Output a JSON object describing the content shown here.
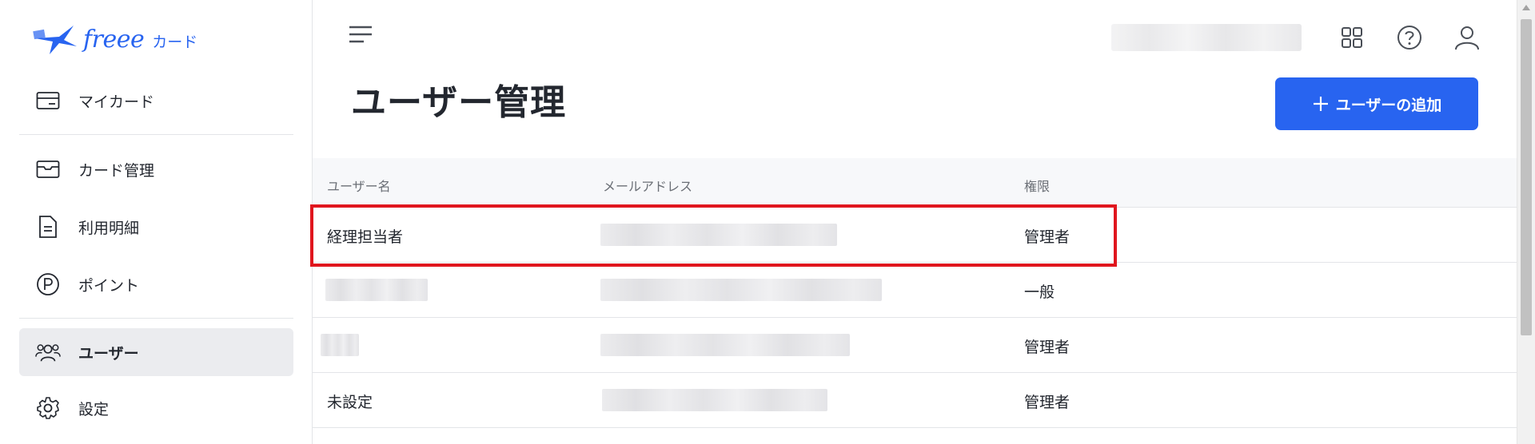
{
  "brand": {
    "logo_text": "freee",
    "logo_sub": "カード",
    "accent": "#2864f0"
  },
  "sidebar": {
    "items": [
      {
        "label": "マイカード",
        "icon": "card-icon"
      },
      {
        "label": "カード管理",
        "icon": "card-box-icon"
      },
      {
        "label": "利用明細",
        "icon": "document-icon"
      },
      {
        "label": "ポイント",
        "icon": "point-icon"
      },
      {
        "label": "ユーザー",
        "icon": "users-icon",
        "active": true
      },
      {
        "label": "設定",
        "icon": "gear-icon"
      }
    ]
  },
  "header": {
    "icons": [
      "menu-icon",
      "apps-grid-icon",
      "help-icon",
      "user-account-icon"
    ]
  },
  "main": {
    "title": "ユーザー管理",
    "add_button": "ユーザーの追加",
    "table": {
      "columns": [
        "ユーザー名",
        "メールアドレス",
        "権限"
      ],
      "rows": [
        {
          "name": "経理担当者",
          "role": "管理者"
        },
        {
          "name": "",
          "role": "一般"
        },
        {
          "name": "",
          "role": "管理者"
        },
        {
          "name": "未設定",
          "role": "管理者"
        }
      ]
    }
  },
  "colors": {
    "highlight": "#e0161e",
    "active_bg": "#ebecef"
  }
}
